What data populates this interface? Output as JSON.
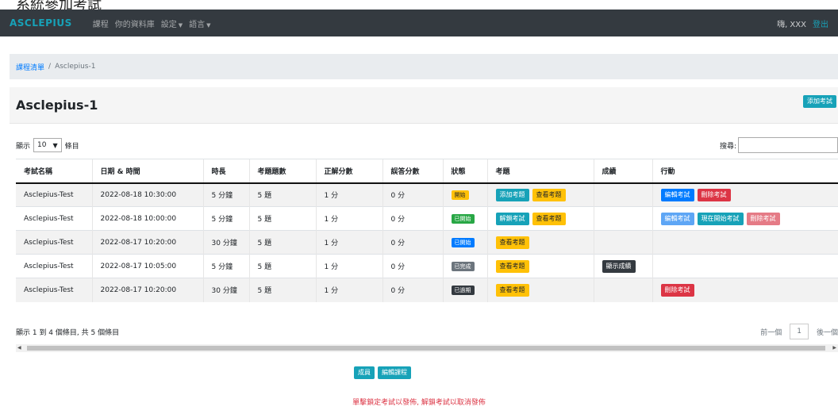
{
  "caption": "系統參加考試",
  "navbar": {
    "brand": "ASCLEPIUS",
    "links": [
      {
        "label": "課程"
      },
      {
        "label": "你的資料庫"
      },
      {
        "label": "設定"
      },
      {
        "label": "語言"
      }
    ],
    "greeting": "嗨, XXX",
    "logout": "登出"
  },
  "breadcrumb": {
    "link": "課程清單",
    "separator": "/",
    "current": "Asclepius-1"
  },
  "page_title": "Asclepius-1",
  "add_exam_label": "添加考試",
  "controls": {
    "show_prefix": "顯示",
    "page_size": "10",
    "show_suffix": "條目",
    "search_label": "搜尋:"
  },
  "table": {
    "headers": [
      "考試名稱",
      "日期 & 時間",
      "時長",
      "考題題數",
      "正解分數",
      "誤答分數",
      "狀態",
      "考題",
      "成績",
      "行動"
    ],
    "rows": [
      {
        "name": "Asclepius-Test",
        "datetime": "2022-08-18 10:30:00",
        "duration": "5 分鐘",
        "count": "5 題",
        "correct": "1 分",
        "wrong": "0 分",
        "status": "開始",
        "q1": "添加考題",
        "q2": "查看考題",
        "grade": "",
        "a1": "編輯考試",
        "a2": "刪除考試",
        "a3": ""
      },
      {
        "name": "Asclepius-Test",
        "datetime": "2022-08-18 10:00:00",
        "duration": "5 分鐘",
        "count": "5 題",
        "correct": "1 分",
        "wrong": "0 分",
        "status": "已開始",
        "q1": "解鎖考試",
        "q2": "查看考題",
        "grade": "",
        "a1": "編輯考試",
        "a2": "現在開始考試",
        "a3": "刪除考試"
      },
      {
        "name": "Asclepius-Test",
        "datetime": "2022-08-17 10:20:00",
        "duration": "30 分鐘",
        "count": "5 題",
        "correct": "1 分",
        "wrong": "0 分",
        "status": "已開始",
        "q1": "查看考題",
        "q2": "",
        "grade": "",
        "a1": "",
        "a2": "",
        "a3": ""
      },
      {
        "name": "Asclepius-Test",
        "datetime": "2022-08-17 10:05:00",
        "duration": "5 分鐘",
        "count": "5 題",
        "correct": "1 分",
        "wrong": "0 分",
        "status": "已完成",
        "q1": "查看考題",
        "q2": "",
        "grade": "顯示成績",
        "a1": "",
        "a2": "",
        "a3": ""
      },
      {
        "name": "Asclepius-Test",
        "datetime": "2022-08-17 10:20:00",
        "duration": "30 分鐘",
        "count": "5 題",
        "correct": "1 分",
        "wrong": "0 分",
        "status": "已過期",
        "q1": "查看考題",
        "q2": "",
        "grade": "",
        "a1": "刪除考試",
        "a2": "",
        "a3": ""
      }
    ]
  },
  "info": "顯示 1 到 4 個條目, 共 5 個條目",
  "pager": {
    "prev": "前一個",
    "page": "1",
    "next": "後一個"
  },
  "bottom": {
    "members": "成員",
    "edit_course": "編輯課程"
  },
  "hint": "單擊鎖定考試以發佈, 解鎖考試以取消發佈"
}
